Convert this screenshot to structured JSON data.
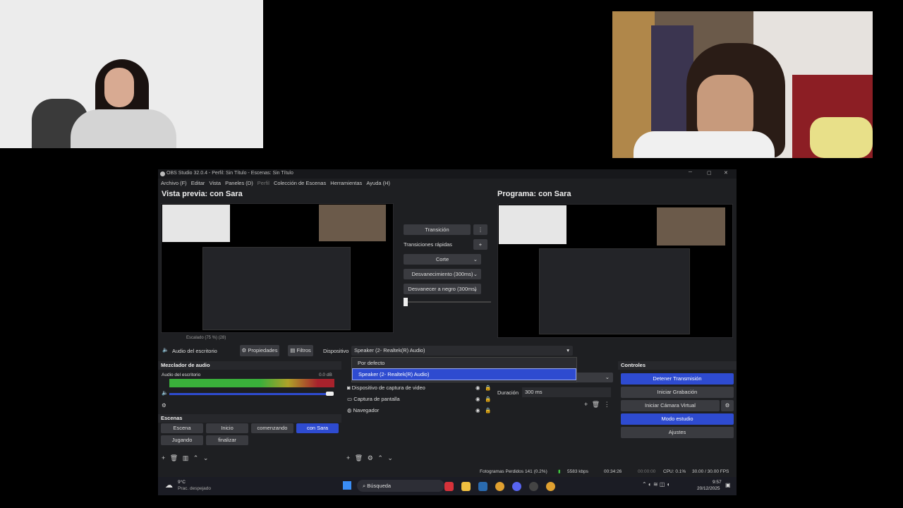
{
  "obs": {
    "window_title": "OBS Studio 32.0.4 - Perfil: Sin Título - Escenas: Sin Título",
    "menu": [
      "Archivo (F)",
      "Editar",
      "Vista",
      "Paneles (D)",
      "Perfil",
      "Colección de Escenas",
      "Herramientas",
      "Ayuda (H)"
    ],
    "preview_title": "Vista previa: con Sara",
    "program_title": "Programa: con Sara",
    "preview_footer": "Escalado (75 %) (28)",
    "transition": {
      "label": "Transición",
      "quick_label": "Transiciones rápidas",
      "items": [
        "Corte",
        "Desvanecimiento (300ms)",
        "Desvanecer a negro (300ms)"
      ]
    },
    "source_bar": {
      "source_name": "Audio del escritorio",
      "properties_label": "Propiedades",
      "filters_label": "Filtros",
      "device_label": "Dispositivo",
      "device_value": "Speaker (2- Realtek(R) Audio)"
    },
    "device_dropdown": {
      "options": [
        "Por defecto",
        "Speaker (2- Realtek(R) Audio)"
      ],
      "selected": "Speaker (2- Realtek(R) Audio)"
    },
    "mixer": {
      "title": "Mezclador de audio",
      "channel": "Audio del escritorio",
      "db": "0.0 dB"
    },
    "scenes": {
      "title": "Escenas",
      "items": [
        "Escena",
        "Inicio",
        "comenzando",
        "con Sara",
        "Jugando",
        "finalizar"
      ],
      "active": "con Sara"
    },
    "sources": {
      "items": [
        "Dispositivo de captura de video",
        "Captura de pantalla",
        "Navegador"
      ]
    },
    "transition_props": {
      "duration_label": "Duración",
      "duration_value": "300 ms"
    },
    "controls": {
      "title": "Controles",
      "stop_stream": "Detener Transmisión",
      "start_recording": "Iniciar Grabación",
      "start_virtual_cam": "Iniciar Cámara Virtual",
      "studio_mode": "Modo estudio",
      "settings": "Ajustes"
    },
    "status": {
      "dropped": "Fotogramas Perdidos 141 (0.2%)",
      "kbps": "5583 kbps",
      "stream_time": "00:34:26",
      "rec_time": "00:00:00",
      "cpu": "CPU: 0.1%",
      "fps": "30.00 / 30.00 FPS"
    }
  },
  "taskbar": {
    "weather_temp": "9°C",
    "weather_desc": "Prac. despejado",
    "search_placeholder": "Búsqueda",
    "time": "9:57",
    "date": "20/12/2025"
  },
  "colors": {
    "accent": "#2e4bd0",
    "meter_green": "#3fc93f",
    "meter_yellow": "#c8b82a",
    "meter_red": "#c0222e"
  }
}
